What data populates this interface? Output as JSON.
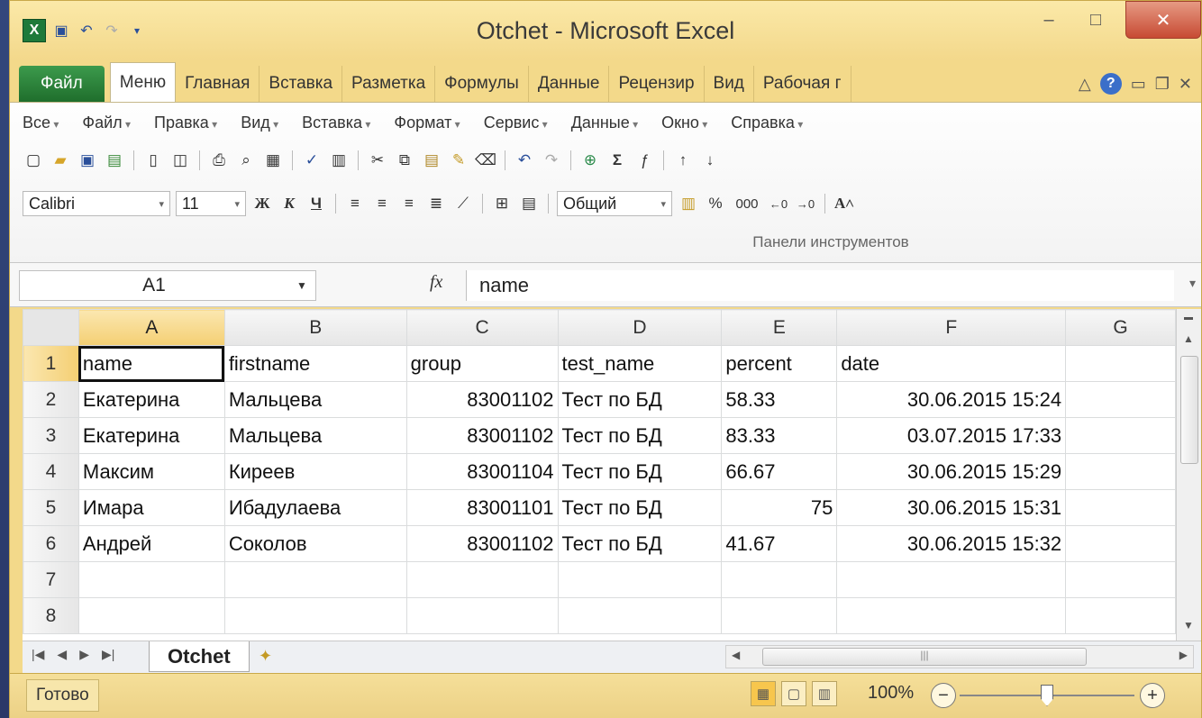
{
  "window": {
    "title": "Otchet  -  Microsoft Excel",
    "min": "–",
    "max": "□",
    "close": "✕"
  },
  "ribbon_tabs": [
    "Файл",
    "Меню",
    "Главная",
    "Вставка",
    "Разметка",
    "Формулы",
    "Данные",
    "Рецензир",
    "Вид",
    "Рабочая г"
  ],
  "menu": [
    "Все",
    "Файл",
    "Правка",
    "Вид",
    "Вставка",
    "Формат",
    "Сервис",
    "Данные",
    "Окно",
    "Справка"
  ],
  "toolbar": {
    "font": "Calibri",
    "size": "11",
    "bold": "Ж",
    "italic": "К",
    "underline": "Ч",
    "number_format": "Общий",
    "percent": "%",
    "thousands": "000",
    "group_label": "Панели инструментов"
  },
  "formula_bar": {
    "cell_ref": "A1",
    "fx": "fx",
    "value": "name"
  },
  "sheet": {
    "columns": [
      "A",
      "B",
      "C",
      "D",
      "E",
      "F",
      "G"
    ],
    "rows": [
      [
        "name",
        "firstname",
        "group",
        "test_name",
        "percent",
        "date",
        ""
      ],
      [
        "Екатерина",
        "Мальцева",
        "83001102",
        "Тест по БД",
        "58.33",
        "30.06.2015 15:24",
        ""
      ],
      [
        "Екатерина",
        "Мальцева",
        "83001102",
        "Тест по БД",
        "83.33",
        "03.07.2015 17:33",
        ""
      ],
      [
        "Максим",
        "Киреев",
        "83001104",
        "Тест по БД",
        "66.67",
        "30.06.2015 15:29",
        ""
      ],
      [
        "Имара",
        "Ибадулаева",
        "83001101",
        "Тест по БД",
        "75",
        "30.06.2015 15:31",
        ""
      ],
      [
        "Андрей",
        "Соколов",
        "83001102",
        "Тест по БД",
        "41.67",
        "30.06.2015 15:32",
        ""
      ],
      [
        "",
        "",
        "",
        "",
        "",
        "",
        ""
      ],
      [
        "",
        "",
        "",
        "",
        "",
        "",
        ""
      ]
    ],
    "row_numbers": [
      "1",
      "2",
      "3",
      "4",
      "5",
      "6",
      "7",
      "8"
    ],
    "tab_name": "Otchet"
  },
  "status": {
    "ready": "Готово",
    "zoom": "100%"
  }
}
